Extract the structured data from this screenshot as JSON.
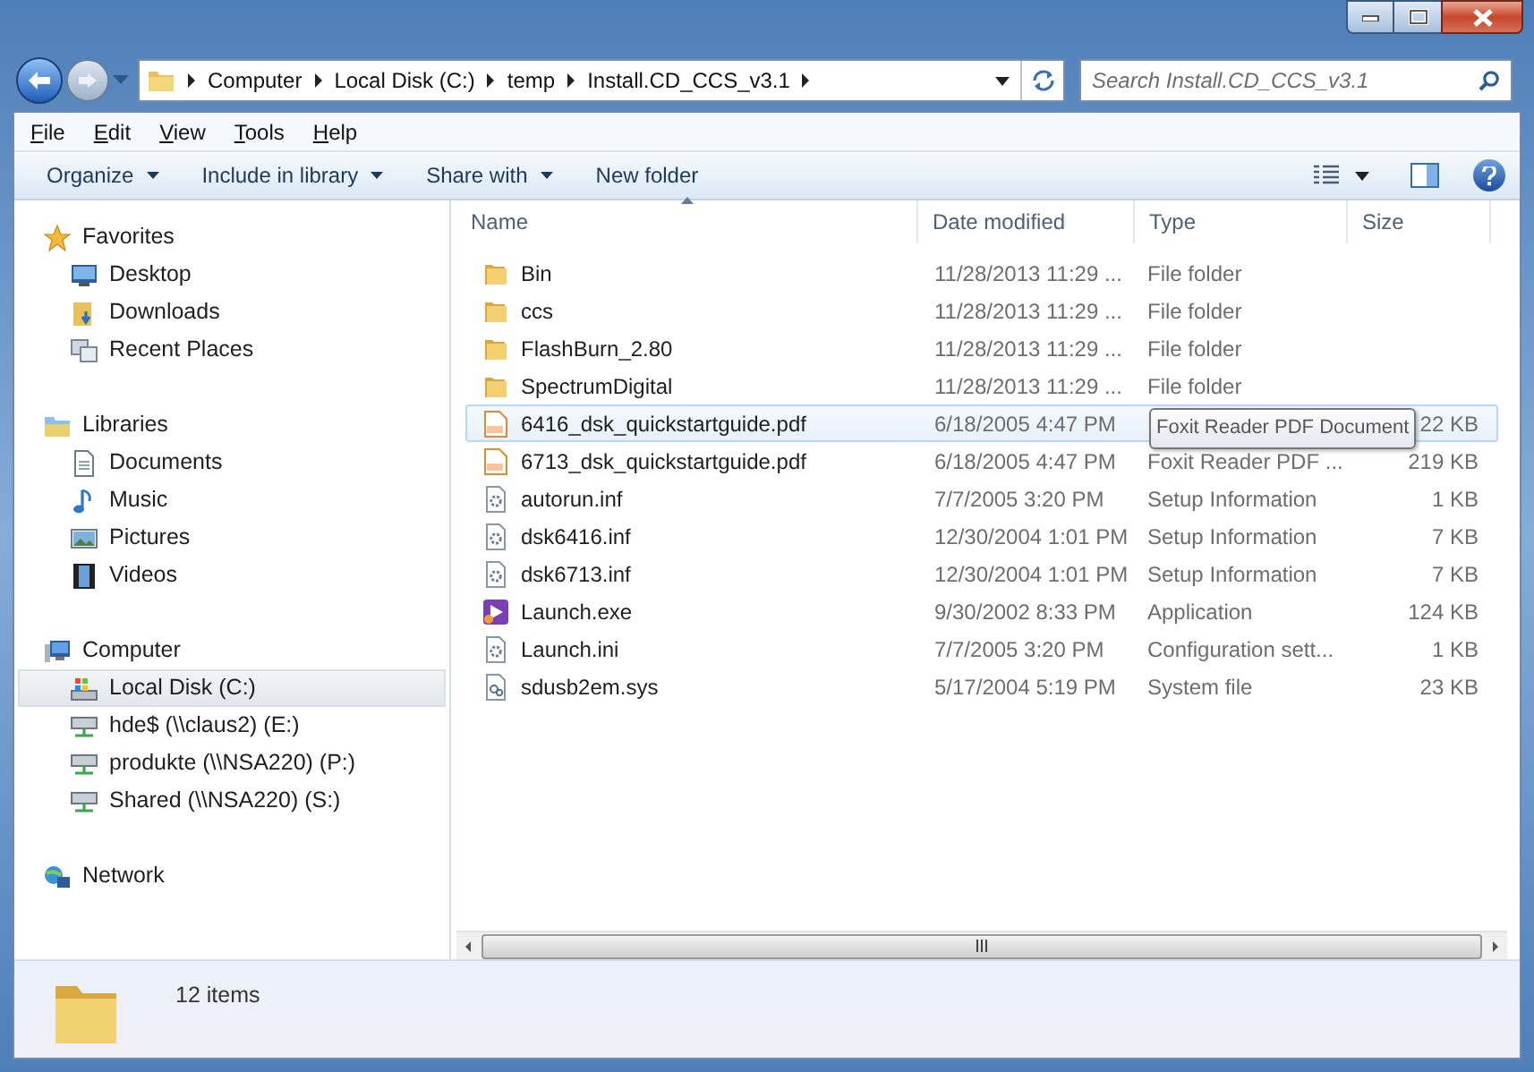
{
  "address": {
    "breadcrumbs": [
      "Computer",
      "Local Disk (C:)",
      "temp",
      "Install.CD_CCS_v3.1"
    ]
  },
  "search": {
    "placeholder": "Search Install.CD_CCS_v3.1"
  },
  "menu": [
    "File",
    "Edit",
    "View",
    "Tools",
    "Help"
  ],
  "toolbar": [
    {
      "label": "Organize",
      "has_menu": true
    },
    {
      "label": "Include in library",
      "has_menu": true
    },
    {
      "label": "Share with",
      "has_menu": true
    },
    {
      "label": "New folder",
      "has_menu": false
    }
  ],
  "sidebar": {
    "groups": [
      {
        "label": "Favorites",
        "kind": "star",
        "items": [
          {
            "label": "Desktop",
            "kind": "desktop",
            "selected": false
          },
          {
            "label": "Downloads",
            "kind": "downloads",
            "selected": false
          },
          {
            "label": "Recent Places",
            "kind": "recent",
            "selected": false
          }
        ]
      },
      {
        "label": "Libraries",
        "kind": "library",
        "items": [
          {
            "label": "Documents",
            "kind": "document",
            "selected": false
          },
          {
            "label": "Music",
            "kind": "music",
            "selected": false
          },
          {
            "label": "Pictures",
            "kind": "pictures",
            "selected": false
          },
          {
            "label": "Videos",
            "kind": "videos",
            "selected": false
          }
        ]
      },
      {
        "label": "Computer",
        "kind": "computer",
        "items": [
          {
            "label": "Local Disk (C:)",
            "kind": "disk",
            "selected": true
          },
          {
            "label": "hde$ (\\\\claus2) (E:)",
            "kind": "netdrive",
            "selected": false
          },
          {
            "label": "produkte (\\\\NSA220) (P:)",
            "kind": "netdrive",
            "selected": false
          },
          {
            "label": "Shared (\\\\NSA220) (S:)",
            "kind": "netdrive",
            "selected": false
          }
        ]
      },
      {
        "label": "Network",
        "kind": "network"
      }
    ]
  },
  "table": {
    "columns": [
      {
        "label": "Name",
        "sorted": true
      },
      {
        "label": "Date modified",
        "sorted": false
      },
      {
        "label": "Type",
        "sorted": false
      },
      {
        "label": "Size",
        "sorted": false
      }
    ],
    "rows": [
      {
        "name": "Bin",
        "kind": "folder",
        "date": "11/28/2013 11:29 ...",
        "type": "File folder",
        "hovered": false
      },
      {
        "name": "ccs",
        "kind": "folder",
        "date": "11/28/2013 11:29 ...",
        "type": "File folder",
        "hovered": false
      },
      {
        "name": "FlashBurn_2.80",
        "kind": "folder",
        "date": "11/28/2013 11:29 ...",
        "type": "File folder",
        "hovered": false
      },
      {
        "name": "SpectrumDigital",
        "kind": "folder",
        "date": "11/28/2013 11:29 ...",
        "type": "File folder",
        "hovered": false
      },
      {
        "name": "6416_dsk_quickstartguide.pdf",
        "kind": "pdf",
        "date": "6/18/2005 4:47 PM",
        "size": "22 KB",
        "hovered": true
      },
      {
        "name": "6713_dsk_quickstartguide.pdf",
        "kind": "pdf",
        "date": "6/18/2005 4:47 PM",
        "type": "Foxit Reader PDF ...",
        "size": "219 KB",
        "hovered": false
      },
      {
        "name": "autorun.inf",
        "kind": "setup",
        "date": "7/7/2005 3:20 PM",
        "type": "Setup Information",
        "size": "1 KB",
        "hovered": false
      },
      {
        "name": "dsk6416.inf",
        "kind": "setup",
        "date": "12/30/2004 1:01 PM",
        "type": "Setup Information",
        "size": "7 KB",
        "hovered": false
      },
      {
        "name": "dsk6713.inf",
        "kind": "setup",
        "date": "12/30/2004 1:01 PM",
        "type": "Setup Information",
        "size": "7 KB",
        "hovered": false
      },
      {
        "name": "Launch.exe",
        "kind": "app",
        "date": "9/30/2002 8:33 PM",
        "type": "Application",
        "size": "124 KB",
        "hovered": false
      },
      {
        "name": "Launch.ini",
        "kind": "setup",
        "date": "7/7/2005 3:20 PM",
        "type": "Configuration sett...",
        "size": "1 KB",
        "hovered": false
      },
      {
        "name": "sdusb2em.sys",
        "kind": "system",
        "date": "5/17/2004 5:19 PM",
        "type": "System file",
        "size": "23 KB",
        "hovered": false
      }
    ]
  },
  "tooltip": {
    "text": "Foxit Reader PDF Document"
  },
  "details": {
    "count": "12 items"
  }
}
